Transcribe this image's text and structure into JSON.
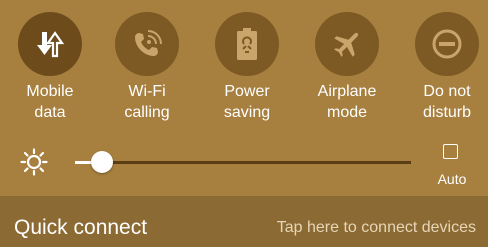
{
  "quick_toggles": [
    {
      "id": "mobile-data",
      "icon": "data-arrows-icon",
      "label_lines": [
        "Mobile",
        "data"
      ],
      "active": true
    },
    {
      "id": "wifi-calling",
      "icon": "wifi-calling-icon",
      "label_lines": [
        "Wi-Fi",
        "calling"
      ],
      "active": false
    },
    {
      "id": "power-saving",
      "icon": "battery-saver-icon",
      "label_lines": [
        "Power",
        "saving"
      ],
      "active": false
    },
    {
      "id": "airplane-mode",
      "icon": "airplane-icon",
      "label_lines": [
        "Airplane",
        "mode"
      ],
      "active": false
    },
    {
      "id": "do-not-disturb",
      "icon": "do-not-disturb-icon",
      "label_lines": [
        "Do not",
        "disturb"
      ],
      "active": false
    }
  ],
  "brightness": {
    "icon": "brightness-sun-icon",
    "level": 0.08,
    "auto_label": "Auto",
    "auto_checked": false
  },
  "quick_connect": {
    "title": "Quick connect",
    "hint": "Tap here to connect devices"
  },
  "colors": {
    "background": "#a77f3e",
    "toggle_circle": "#7d5a24",
    "quick_connect_bar": "#8c6a33"
  }
}
